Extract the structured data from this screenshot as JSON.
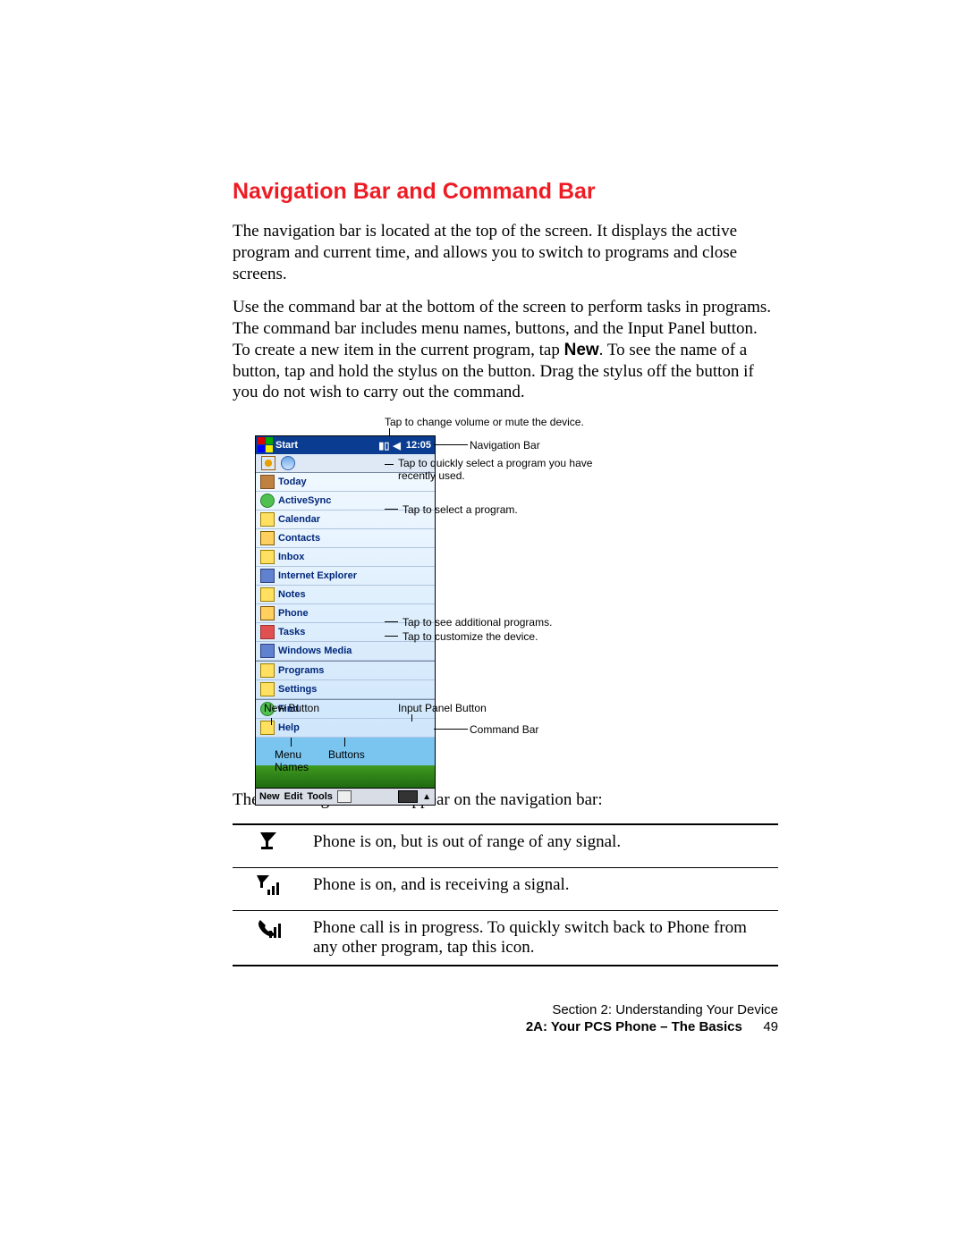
{
  "title": "Navigation Bar and Command Bar",
  "para1": "The navigation bar is located at the top of the screen. It displays the active program and current time, and allows you to switch to programs and close screens.",
  "para2a": "Use the command bar at the bottom of the screen to perform tasks in programs. The command bar includes menu names, buttons, and the Input Panel button. To create a new item in the current program, tap ",
  "para2b_bold": "New",
  "para2c": ". To see the name of a button, tap and hold the stylus on the button. Drag the stylus off the button if you do not wish to carry out the command.",
  "caption_top": "Tap to change volume or mute the device.",
  "nav": {
    "start": "Start",
    "time": "12:05"
  },
  "menu": [
    "Today",
    "ActiveSync",
    "Calendar",
    "Contacts",
    "Inbox",
    "Internet Explorer",
    "Notes",
    "Phone",
    "Tasks",
    "Windows Media",
    "Programs",
    "Settings",
    "Find",
    "Help"
  ],
  "cmd": {
    "new": "New",
    "edit": "Edit",
    "tools": "Tools"
  },
  "rcap": {
    "navbar": "Navigation Bar",
    "recent": "Tap to quickly select a program you have recently used.",
    "menuitem": "Tap to select a program.",
    "programs": "Tap to see additional programs.",
    "settings": "Tap to customize the device.",
    "cmdbar": "Command Bar",
    "inputbtn": "Input Panel Button"
  },
  "bcap": {
    "newbtn": "New Button",
    "menunames": "Menu Names",
    "buttons": "Buttons"
  },
  "para3": "The following icons will appear on the navigation bar:",
  "icons": [
    {
      "desc": "Phone is on, but is out of range of any signal."
    },
    {
      "desc": "Phone is on, and is receiving a signal."
    },
    {
      "desc": "Phone call is in progress. To quickly switch back to Phone from any other program, tap this icon."
    }
  ],
  "footer": {
    "line1": "Section 2: Understanding Your Device",
    "line2": "2A: Your PCS Phone – The Basics",
    "page": "49"
  }
}
